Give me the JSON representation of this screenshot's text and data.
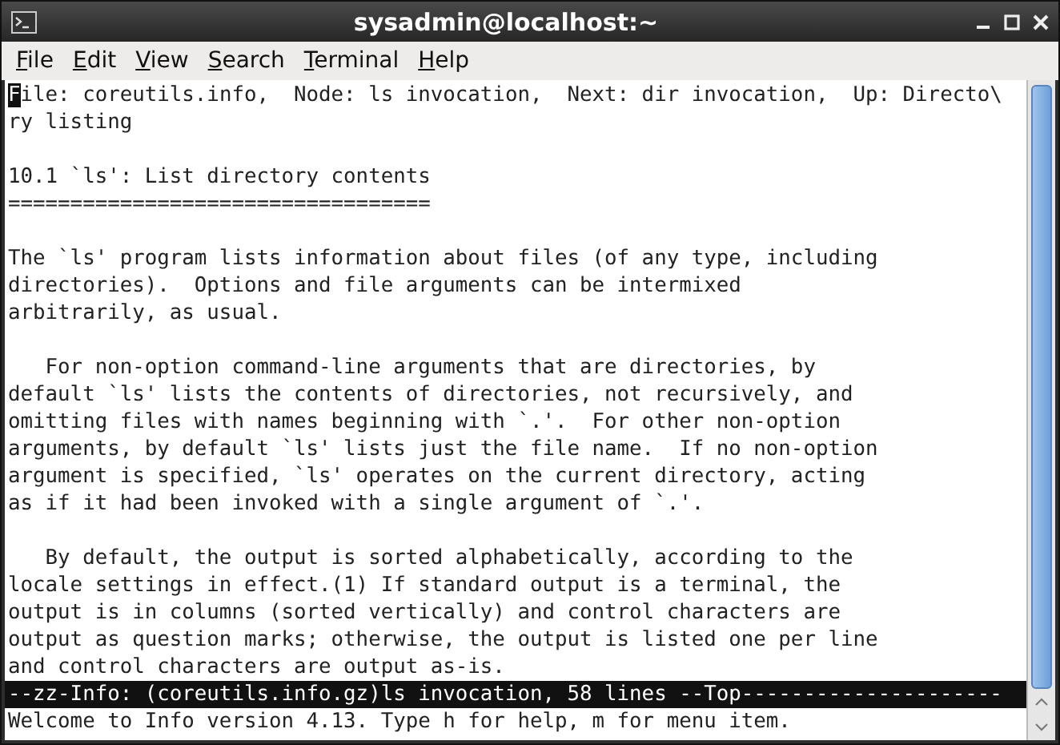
{
  "window": {
    "title": "sysadmin@localhost:~"
  },
  "menu": [
    {
      "label": "File"
    },
    {
      "label": "Edit"
    },
    {
      "label": "View"
    },
    {
      "label": "Search"
    },
    {
      "label": "Terminal"
    },
    {
      "label": "Help"
    }
  ],
  "lines": [
    {
      "kind": "text",
      "text": "File: coreutils.info,  Node: ls invocation,  Next: dir invocation,  Up: Directo\\",
      "cursor": true
    },
    {
      "kind": "text",
      "text": "ry listing",
      "cursor": false
    },
    {
      "kind": "blank"
    },
    {
      "kind": "text",
      "text": "10.1 `ls': List directory contents",
      "cursor": false
    },
    {
      "kind": "text",
      "text": "==================================",
      "cursor": false
    },
    {
      "kind": "blank"
    },
    {
      "kind": "text",
      "text": "The `ls' program lists information about files (of any type, including",
      "cursor": false
    },
    {
      "kind": "text",
      "text": "directories).  Options and file arguments can be intermixed",
      "cursor": false
    },
    {
      "kind": "text",
      "text": "arbitrarily, as usual.",
      "cursor": false
    },
    {
      "kind": "blank"
    },
    {
      "kind": "text",
      "text": "   For non-option command-line arguments that are directories, by",
      "cursor": false
    },
    {
      "kind": "text",
      "text": "default `ls' lists the contents of directories, not recursively, and",
      "cursor": false
    },
    {
      "kind": "text",
      "text": "omitting files with names beginning with `.'.  For other non-option",
      "cursor": false
    },
    {
      "kind": "text",
      "text": "arguments, by default `ls' lists just the file name.  If no non-option",
      "cursor": false
    },
    {
      "kind": "text",
      "text": "argument is specified, `ls' operates on the current directory, acting",
      "cursor": false
    },
    {
      "kind": "text",
      "text": "as if it had been invoked with a single argument of `.'.",
      "cursor": false
    },
    {
      "kind": "blank"
    },
    {
      "kind": "text",
      "text": "   By default, the output is sorted alphabetically, according to the",
      "cursor": false
    },
    {
      "kind": "text",
      "text": "locale settings in effect.(1) If standard output is a terminal, the",
      "cursor": false
    },
    {
      "kind": "text",
      "text": "output is in columns (sorted vertically) and control characters are",
      "cursor": false
    },
    {
      "kind": "text",
      "text": "output as question marks; otherwise, the output is listed one per line",
      "cursor": false
    },
    {
      "kind": "text",
      "text": "and control characters are output as-is.",
      "cursor": false
    },
    {
      "kind": "status",
      "text": "--zz-Info: (coreutils.info.gz)ls invocation, 58 lines --Top---------------------",
      "cursor": false
    },
    {
      "kind": "text",
      "text": "Welcome to Info version 4.13. Type h for help, m for menu item.",
      "cursor": false
    }
  ]
}
